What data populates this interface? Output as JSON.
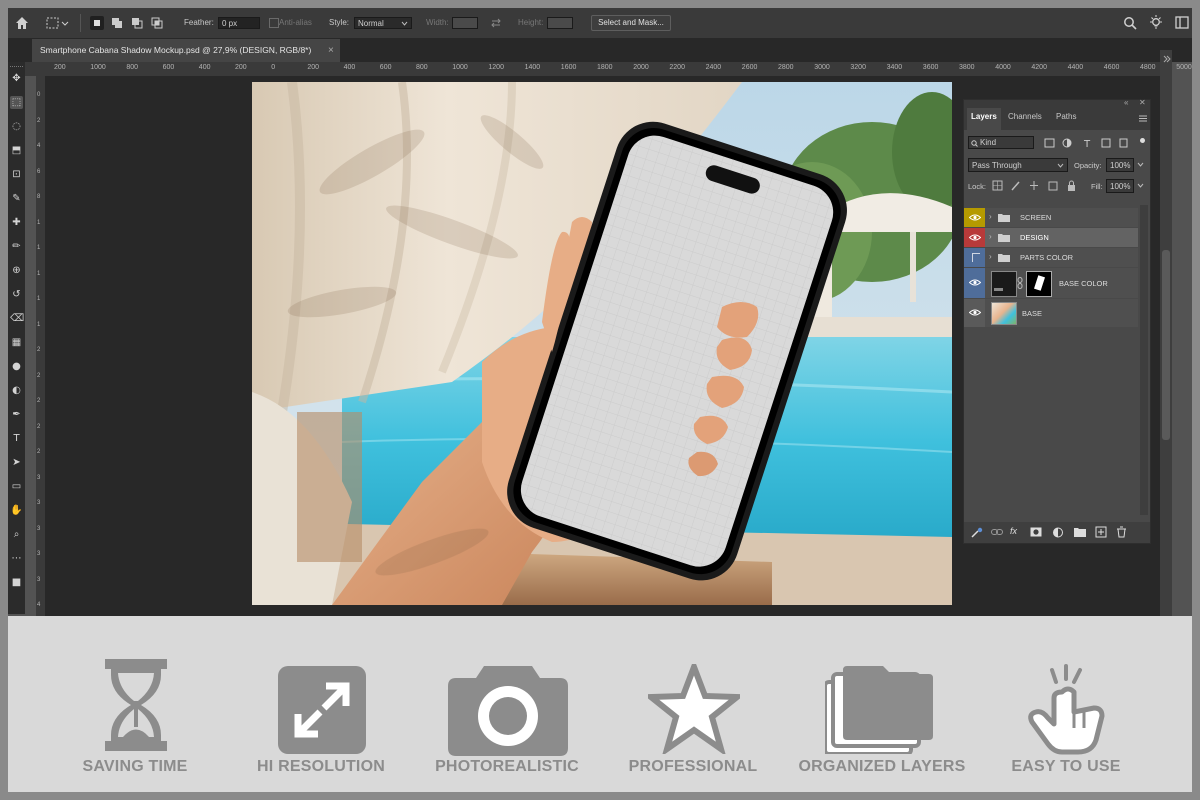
{
  "options_bar": {
    "feather_label": "Feather:",
    "feather_value": "0 px",
    "anti_alias_label": "Anti-alias",
    "style_label": "Style:",
    "style_value": "Normal",
    "width_label": "Width:",
    "height_label": "Height:",
    "select_mask_label": "Select and Mask..."
  },
  "document_tab": {
    "title": "Smartphone Cabana Shadow Mockup.psd @ 27,9% (DESIGN, RGB/8*)",
    "close": "×"
  },
  "ruler": {
    "ticks": [
      "200",
      "1000",
      "800",
      "600",
      "400",
      "200",
      "0",
      "200",
      "400",
      "600",
      "800",
      "1000",
      "1200",
      "1400",
      "1600",
      "1800",
      "2000",
      "2200",
      "2400",
      "2600",
      "2800",
      "3000",
      "3200",
      "3400",
      "3600",
      "3800",
      "4000",
      "4200",
      "4400",
      "4600",
      "4800",
      "5000"
    ],
    "vticks": [
      "0",
      "2",
      "4",
      "6",
      "8",
      "1",
      "1",
      "1",
      "1",
      "1",
      "2",
      "2",
      "2",
      "2",
      "2",
      "3",
      "3",
      "3",
      "3",
      "3",
      "4"
    ]
  },
  "layers_panel": {
    "tabs": [
      "Layers",
      "Channels",
      "Paths"
    ],
    "kind_label": "Kind",
    "blend_mode": "Pass Through",
    "opacity_label": "Opacity:",
    "opacity_value": "100%",
    "lock_label": "Lock:",
    "fill_label": "Fill:",
    "fill_value": "100%",
    "layers": [
      {
        "name": "SCREEN",
        "color": "#b59a00",
        "type": "group"
      },
      {
        "name": "DESIGN",
        "color": "#b83a3a",
        "type": "group",
        "selected": true
      },
      {
        "name": "PARTS COLOR",
        "color": "#4f6d9a",
        "type": "group",
        "hidden": true
      },
      {
        "name": "BASE COLOR",
        "color": "#4f6d9a",
        "type": "smart"
      },
      {
        "name": "BASE",
        "color": "#5a5a5a",
        "type": "image"
      }
    ]
  },
  "features": [
    {
      "label": "SAVING TIME",
      "icon": "hourglass-icon"
    },
    {
      "label": "HI RESOLUTION",
      "icon": "expand-icon"
    },
    {
      "label": "PHOTOREALISTIC",
      "icon": "camera-icon"
    },
    {
      "label": "PROFESSIONAL",
      "icon": "star-icon"
    },
    {
      "label": "ORGANIZED LAYERS",
      "icon": "layers-icon"
    },
    {
      "label": "EASY TO USE",
      "icon": "tap-icon"
    }
  ],
  "colors": {
    "ui_dark": "#3a3a3a",
    "panel": "#494949",
    "strip": "#d9d9d9",
    "feature_gray": "#8c8c8c"
  }
}
